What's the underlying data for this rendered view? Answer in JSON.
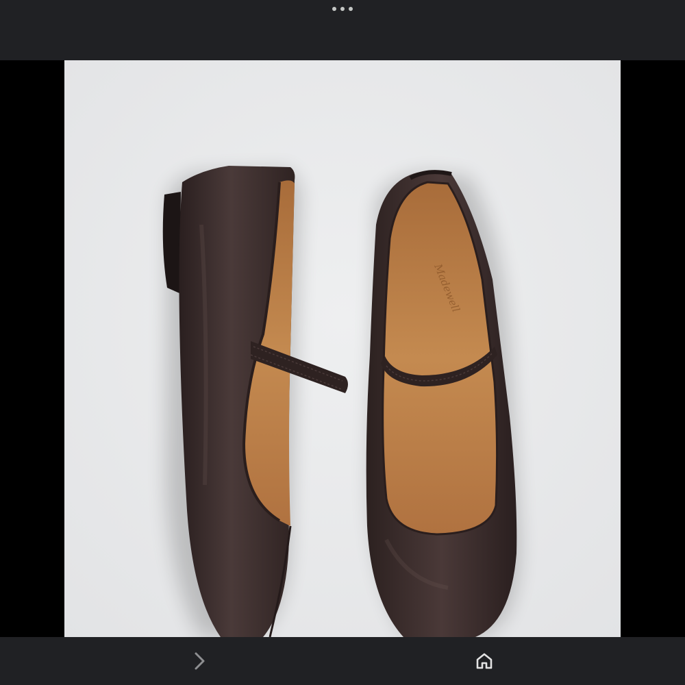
{
  "top_bar": {
    "menu_icon": "more-horizontal-icon"
  },
  "viewer": {
    "image_description_icon": "photo",
    "shoe_color": "#3a2c2b",
    "lining_color": "#b8773e",
    "background_color": "#e9eaeb"
  },
  "bottom_bar": {
    "forward_icon": "chevron-right-icon",
    "home_icon": "home-icon"
  },
  "colors": {
    "bar": "#202124",
    "icon": "#e3e3e3",
    "icon_dim": "#8e8f91"
  }
}
